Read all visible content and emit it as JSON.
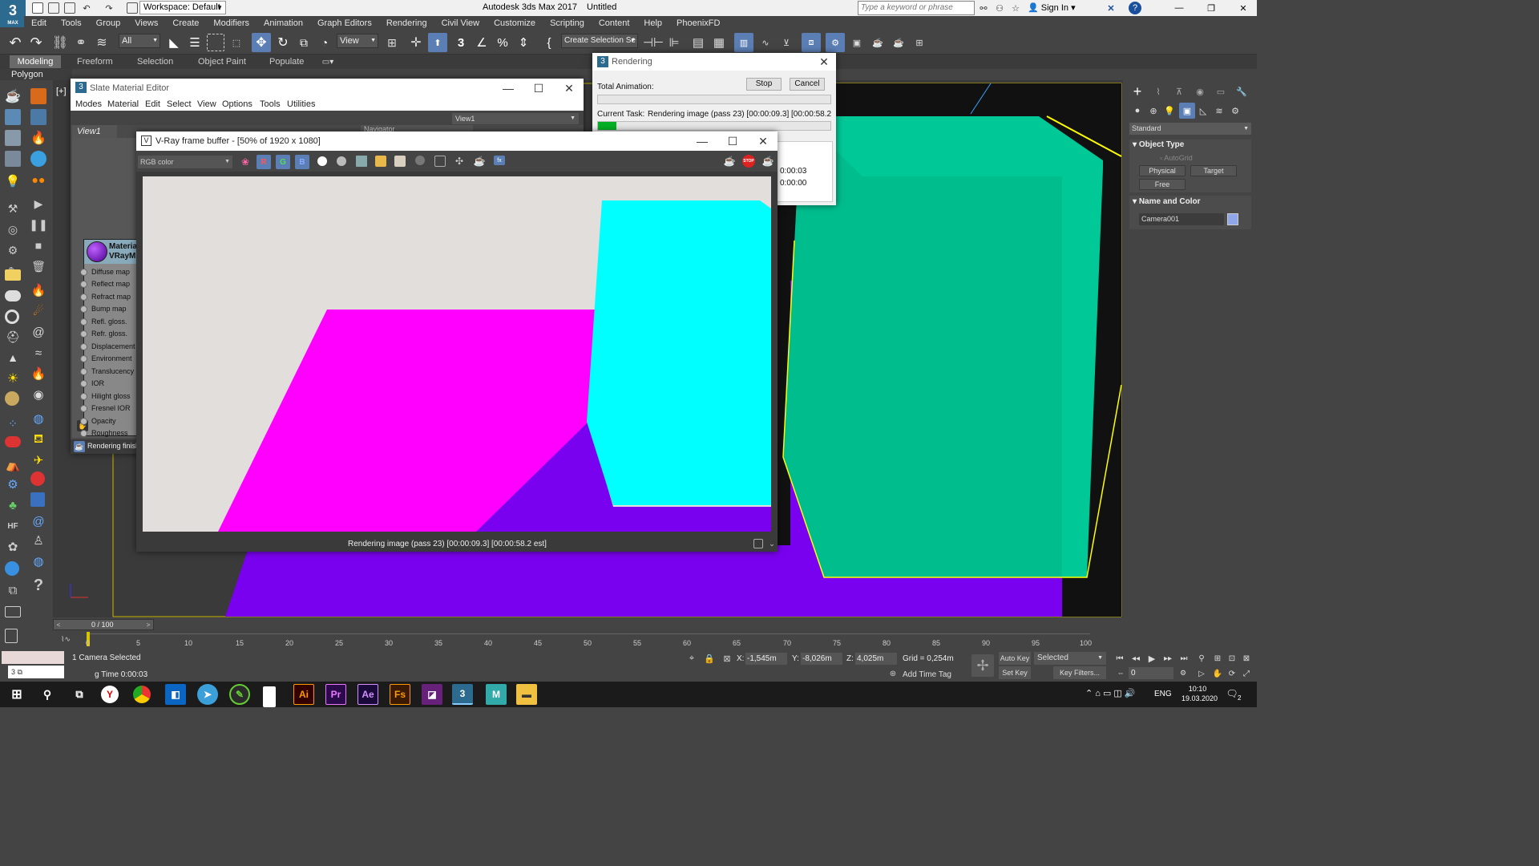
{
  "app": {
    "title": "Autodesk 3ds Max 2017",
    "file": "Untitled",
    "logo": "MAX",
    "workspace": "Workspace: Default",
    "search_placeholder": "Type a keyword or phrase",
    "sign_in": "Sign In"
  },
  "menu": [
    "Edit",
    "Tools",
    "Group",
    "Views",
    "Create",
    "Modifiers",
    "Animation",
    "Graph Editors",
    "Rendering",
    "Civil View",
    "Customize",
    "Scripting",
    "Content",
    "Help",
    "PhoenixFD"
  ],
  "toolbar": {
    "filter": "All",
    "refcoord": "View",
    "selection_set": "Create Selection Se"
  },
  "ribbon_tabs": [
    "Modeling",
    "Freeform",
    "Selection",
    "Object Paint",
    "Populate"
  ],
  "ribbon_sub": "Polygon Modeling",
  "viewport_label": "[+]",
  "slate": {
    "title": "Slate Material Editor",
    "menu": [
      "Modes",
      "Material",
      "Edit",
      "Select",
      "View",
      "Options",
      "Tools",
      "Utilities"
    ],
    "view_tab": "View1",
    "view_dropdown": "View1",
    "navigator": "Navigator",
    "node_title1": "Materia",
    "node_title2": "VRayM",
    "slots": [
      "Diffuse map",
      "Reflect map",
      "Refract map",
      "Bump map",
      "Refl. gloss.",
      "Refr. gloss.",
      "Displacement",
      "Environment",
      "Translucency",
      "IOR",
      "Hilight gloss",
      "Fresnel IOR",
      "Opacity",
      "Roughness"
    ],
    "status": "Rendering finish"
  },
  "rendering": {
    "title": "Rendering",
    "total_label": "Total Animation:",
    "stop": "Stop",
    "cancel": "Cancel",
    "task_label": "Current Task:",
    "task_value": "Rendering image (pass 23) [00:00:09.3] [00:00:58.2",
    "total_progress": 0.0,
    "task_progress": 0.08,
    "time1": "0:00:03",
    "time2": "0:00:00"
  },
  "vfb": {
    "title": "V-Ray frame buffer - [50% of 1920 x 1080]",
    "channel": "RGB color",
    "status": "Rendering image (pass 23) [00:00:09.3] [00:00:58.2 est]"
  },
  "command_panel": {
    "dropdown": "Standard",
    "object_type_header": "Object Type",
    "autogrid": "AutoGrid",
    "buttons": [
      "Physical",
      "Target",
      "Free"
    ],
    "name_color_header": "Name and Color",
    "name_value": "Camera001",
    "swatch_color": "#8fa6e8"
  },
  "timeline": {
    "counter": "0 / 100",
    "ticks": [
      "0",
      "5",
      "10",
      "15",
      "20",
      "25",
      "30",
      "35",
      "40",
      "45",
      "50",
      "55",
      "60",
      "65",
      "70",
      "75",
      "80",
      "85",
      "90",
      "95",
      "100"
    ]
  },
  "status": {
    "selection": "1 Camera Selected",
    "render_time": "g Time 0:00:03",
    "x_label": "X:",
    "x": "-1,545m",
    "y_label": "Y:",
    "y": "-8,026m",
    "z_label": "Z:",
    "z": "4,025m",
    "grid": "Grid = 0,254m",
    "add_time_tag": "Add Time Tag",
    "auto_key": "Auto Key",
    "selected": "Selected",
    "set_key": "Set Key",
    "key_filters": "Key Filters...",
    "frame": "0"
  },
  "taskbar": {
    "apps": [
      "Ai",
      "Pr",
      "Ae",
      "Fs"
    ],
    "lang": "ENG",
    "time": "10:10",
    "date": "19.03.2020",
    "notif": "2"
  },
  "colors": {
    "magenta": "#ff00ff",
    "cyan": "#00ffff",
    "violet": "#7a00f0",
    "teal": "#00c896",
    "bg": "#e2dedc"
  }
}
